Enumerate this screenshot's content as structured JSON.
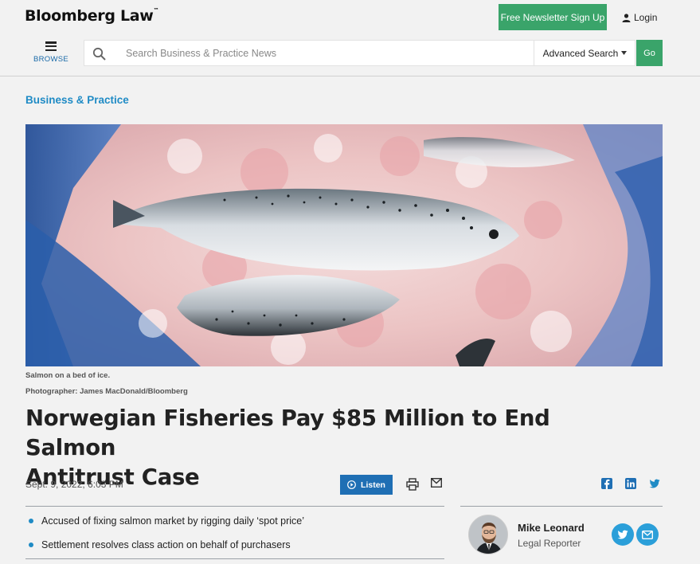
{
  "header": {
    "logo": "Bloomberg Law",
    "newsletter_button": "Free Newsletter Sign Up",
    "login": "Login",
    "browse": "BROWSE",
    "search_placeholder": "Search Business & Practice News",
    "advanced_search": "Advanced Search",
    "go": "Go"
  },
  "article": {
    "section": "Business & Practice",
    "image_caption": "Salmon on a bed of ice.",
    "photo_credit": "Photographer: James MacDonald/Bloomberg",
    "headline_line1": "Norwegian Fisheries Pay $85 Million to End Salmon",
    "headline_line2": "Antitrust Case",
    "date": "Sept. 9, 2022, 6:03 PM",
    "listen": "Listen",
    "bullets": [
      "Accused of fixing salmon market by rigging daily ‘spot price’",
      "Settlement resolves class action on behalf of purchasers"
    ]
  },
  "author": {
    "name": "Mike Leonard",
    "role": "Legal Reporter"
  },
  "colors": {
    "accent_green": "#3aa46a",
    "link_blue": "#1f8bc5",
    "listen_blue": "#1f6fb4",
    "social_blue": "#2b9fd9"
  },
  "icons": {
    "share": [
      "facebook-icon",
      "linkedin-icon",
      "twitter-icon"
    ],
    "author_actions": [
      "twitter-icon",
      "email-icon"
    ]
  }
}
